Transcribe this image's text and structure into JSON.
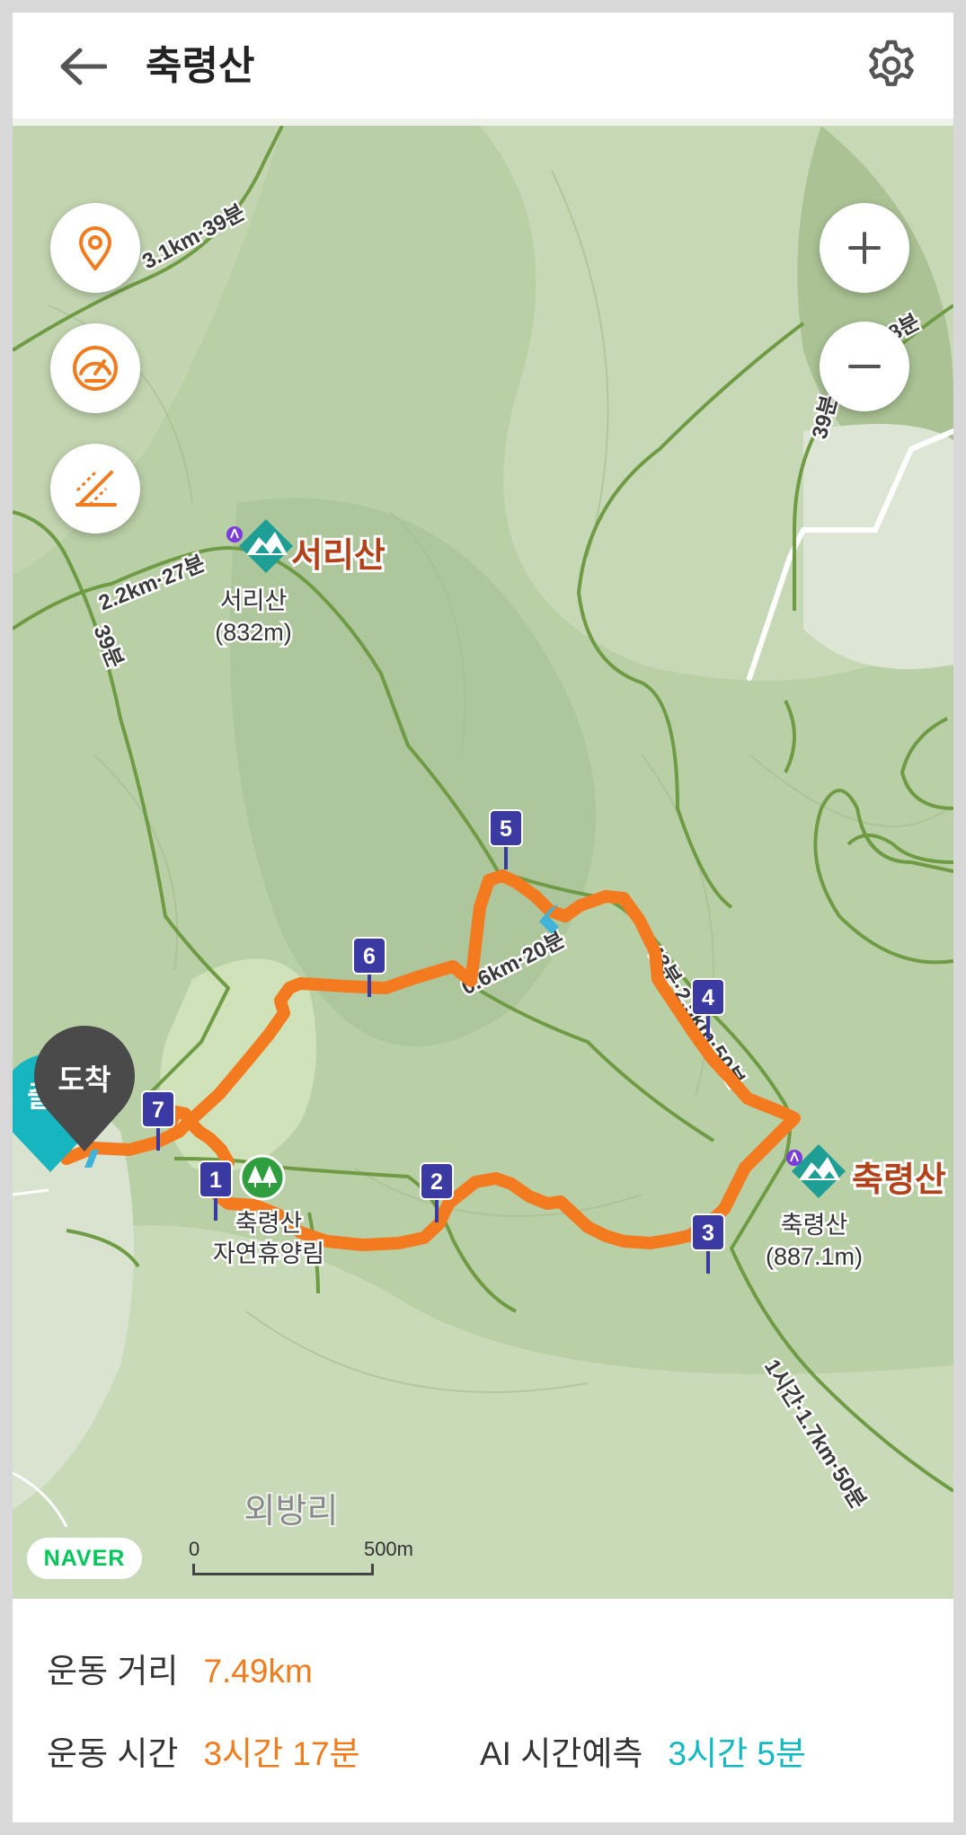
{
  "header": {
    "title": "축령산"
  },
  "map": {
    "trail_labels": [
      "3.1km·39분",
      "8분",
      "39분",
      "2.2km·27분",
      "39분",
      "0.6km·20분",
      "43분·2.5km·50분",
      "1시간·1.7km·50분"
    ],
    "peaks": [
      {
        "name": "서리산",
        "label": "서리산",
        "height": "(832m)"
      },
      {
        "name": "축령산",
        "label": "축령산",
        "height": "(887.1m)"
      }
    ],
    "forest": {
      "line1": "축령산",
      "line2": "자연휴양림"
    },
    "place_label": "외방리",
    "waypoints": [
      "1",
      "2",
      "3",
      "4",
      "5",
      "6",
      "7"
    ],
    "start_label": "출",
    "arrival_label": "도착",
    "naver_logo": "NAVER",
    "scale": {
      "start": "0",
      "end": "500m"
    },
    "route_color": "#f47a20",
    "trail_color": "#6f9b45"
  },
  "stats": {
    "distance_label": "운동 거리",
    "distance_value": "7.49km",
    "time_label": "운동 시간",
    "time_value": "3시간 17분",
    "ai_label": "AI 시간예측",
    "ai_value": "3시간 5분"
  }
}
